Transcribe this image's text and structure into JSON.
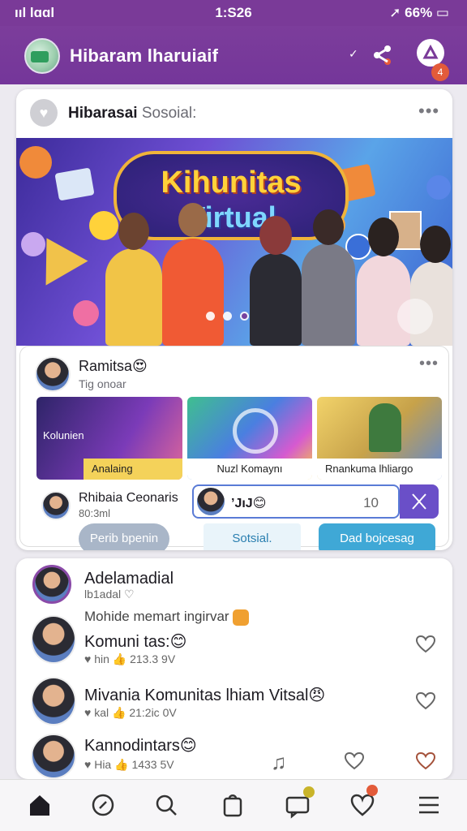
{
  "status_bar": {
    "signal": "ııl lɑɑl",
    "time": "1:S26",
    "battery": "66%"
  },
  "header": {
    "title": "Hibaram lharuiaif",
    "notification_count": "4"
  },
  "post_card": {
    "group_name_bold": "Hibarasai",
    "group_name_light": "Sosoial:",
    "banner": {
      "title_line1": "Kihunitas",
      "title_line2": "Virtual",
      "slide_count": 3,
      "active_slide": 3
    },
    "inner_card": {
      "author": "Ramitsa😍",
      "author_sub": "Tig onoar",
      "tiles": [
        {
          "overlay": "Kolunien",
          "caption": "Analaing"
        },
        {
          "caption": "Nuzl Komaynı"
        },
        {
          "caption": "Rnankuma lhliargo"
        }
      ],
      "comment_user": "Rhibaia Ceonaris",
      "comment_time": "80:3ml",
      "reply_text": "ʼJıJ😊",
      "reply_count": "10",
      "buttons": {
        "left": "Perib bpenin",
        "middle": "Sotsial.",
        "right": "Dad bojcesag"
      }
    }
  },
  "feed_card": {
    "top_user": "Adelamadial",
    "top_sub": "lb1adal",
    "section_label": "Mohide memart ingirvar",
    "items": [
      {
        "title": "Komuni tas:😊",
        "meta_a": "hin",
        "meta_b": "213.3 9V"
      },
      {
        "title": "Mivania Komunitas lhiam Vitsal😠",
        "meta_a": "kal",
        "meta_b": "21:2ic 0V"
      },
      {
        "title": "Kannodintars😊",
        "meta_a": "Hia",
        "meta_b": "1433 5V"
      }
    ]
  },
  "bottom_nav": [
    "home",
    "explore",
    "search",
    "bag",
    "chat",
    "favorites",
    "menu"
  ]
}
